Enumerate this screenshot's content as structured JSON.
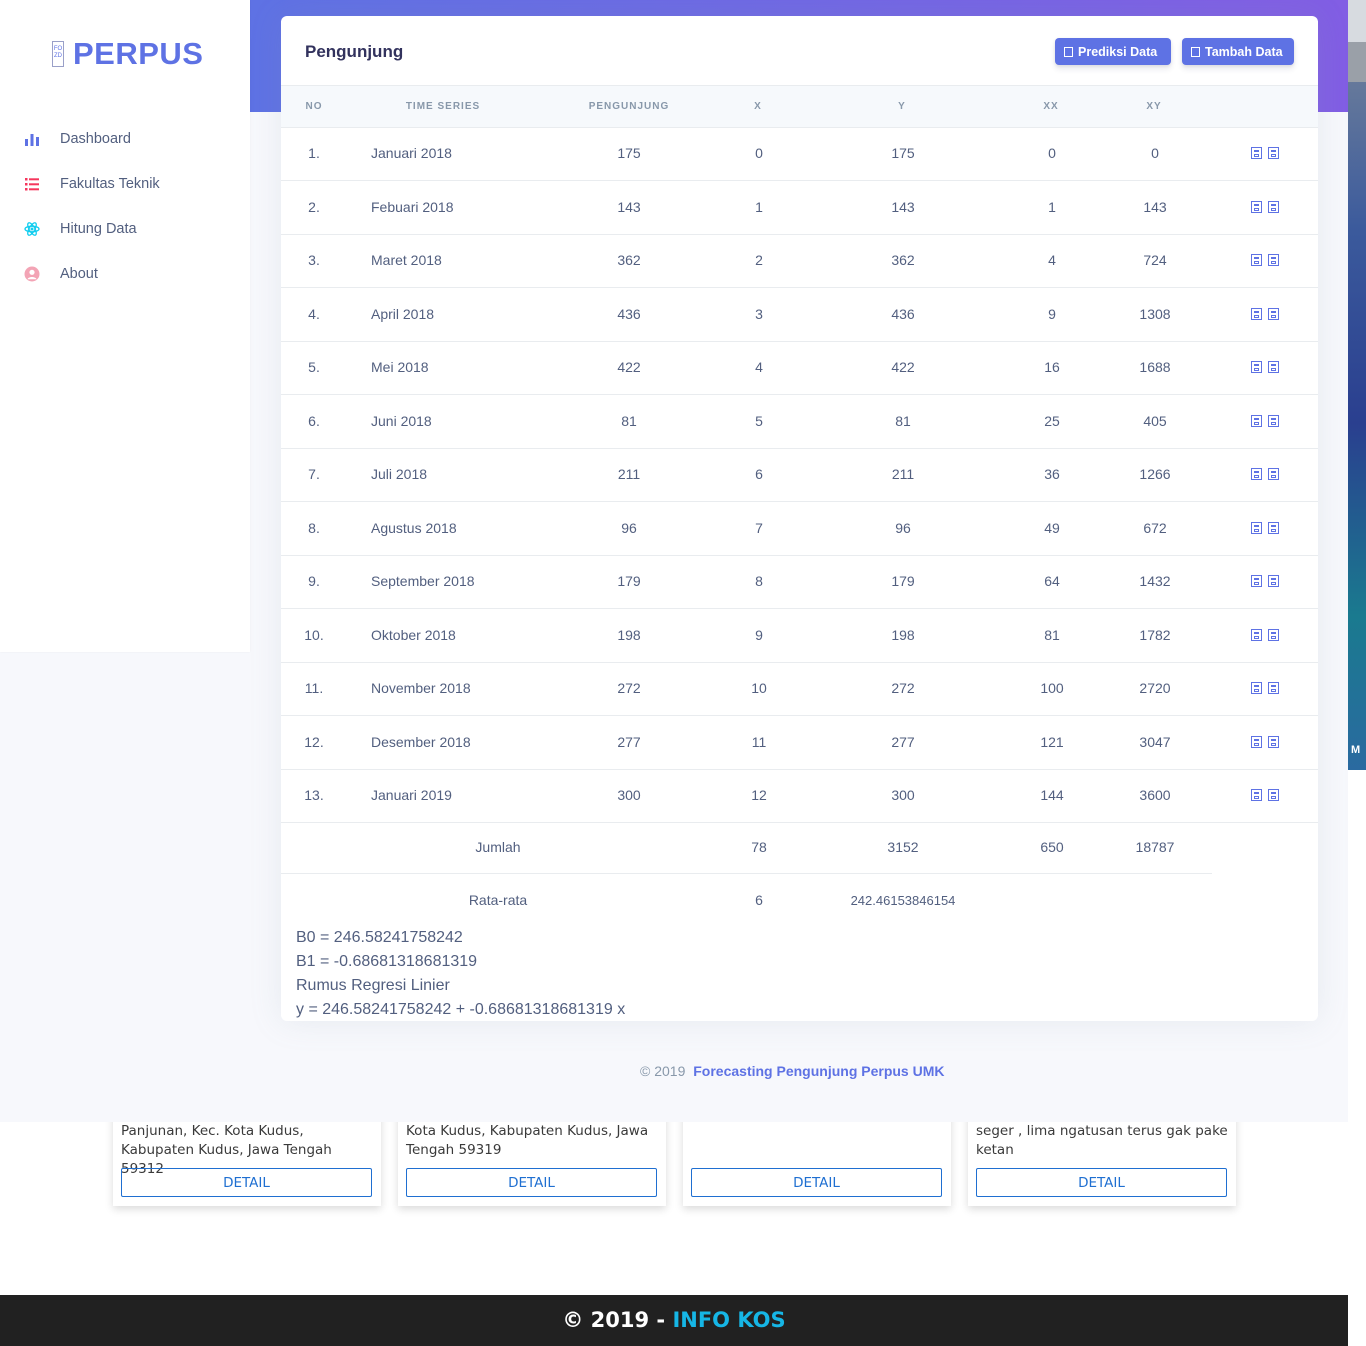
{
  "app": {
    "brand": "PERPUS",
    "brand_logo_text": "FO ZD"
  },
  "sidebar": {
    "items": [
      {
        "label": "Dashboard",
        "icon": "bar-chart-icon",
        "color": "#5e72e4"
      },
      {
        "label": "Fakultas Teknik",
        "icon": "list-icon",
        "color": "#f5365c"
      },
      {
        "label": "Hitung Data",
        "icon": "atom-icon",
        "color": "#11cdef"
      },
      {
        "label": "About",
        "icon": "user-circle-icon",
        "color": "#f3a4b5"
      }
    ]
  },
  "card": {
    "title": "Pengunjung",
    "buttons": {
      "predict_label": "Prediksi Data",
      "add_label": "Tambah Data"
    }
  },
  "table": {
    "headers": [
      "NO",
      "TIME SERIES",
      "PENGUNJUNG",
      "X",
      "Y",
      "XX",
      "XY"
    ],
    "rows": [
      {
        "no": "1.",
        "time": "Januari 2018",
        "pengunjung": "175",
        "x": "0",
        "y": "175",
        "xx": "0",
        "xy": "0"
      },
      {
        "no": "2.",
        "time": "Febuari 2018",
        "pengunjung": "143",
        "x": "1",
        "y": "143",
        "xx": "1",
        "xy": "143"
      },
      {
        "no": "3.",
        "time": "Maret 2018",
        "pengunjung": "362",
        "x": "2",
        "y": "362",
        "xx": "4",
        "xy": "724"
      },
      {
        "no": "4.",
        "time": "April 2018",
        "pengunjung": "436",
        "x": "3",
        "y": "436",
        "xx": "9",
        "xy": "1308"
      },
      {
        "no": "5.",
        "time": "Mei 2018",
        "pengunjung": "422",
        "x": "4",
        "y": "422",
        "xx": "16",
        "xy": "1688"
      },
      {
        "no": "6.",
        "time": "Juni 2018",
        "pengunjung": "81",
        "x": "5",
        "y": "81",
        "xx": "25",
        "xy": "405"
      },
      {
        "no": "7.",
        "time": "Juli 2018",
        "pengunjung": "211",
        "x": "6",
        "y": "211",
        "xx": "36",
        "xy": "1266"
      },
      {
        "no": "8.",
        "time": "Agustus 2018",
        "pengunjung": "96",
        "x": "7",
        "y": "96",
        "xx": "49",
        "xy": "672"
      },
      {
        "no": "9.",
        "time": "September 2018",
        "pengunjung": "179",
        "x": "8",
        "y": "179",
        "xx": "64",
        "xy": "1432"
      },
      {
        "no": "10.",
        "time": "Oktober 2018",
        "pengunjung": "198",
        "x": "9",
        "y": "198",
        "xx": "81",
        "xy": "1782"
      },
      {
        "no": "11.",
        "time": "November 2018",
        "pengunjung": "272",
        "x": "10",
        "y": "272",
        "xx": "100",
        "xy": "2720"
      },
      {
        "no": "12.",
        "time": "Desember 2018",
        "pengunjung": "277",
        "x": "11",
        "y": "277",
        "xx": "121",
        "xy": "3047"
      },
      {
        "no": "13.",
        "time": "Januari 2019",
        "pengunjung": "300",
        "x": "12",
        "y": "300",
        "xx": "144",
        "xy": "3600"
      }
    ],
    "sum": {
      "label": "Jumlah",
      "x": "78",
      "y": "3152",
      "xx": "650",
      "xy": "18787"
    },
    "avg": {
      "label": "Rata-rata",
      "x": "6",
      "y": "242.46153846154"
    }
  },
  "results": {
    "b0": "B0 = 246.58241758242",
    "b1": "B1 = -0.68681318681319",
    "formula_title": "Rumus Regresi Linier",
    "formula": "y = 246.58241758242 + -0.68681318681319 x"
  },
  "footer": {
    "copyright": "© 2019",
    "link": "Forecasting Pengunjung Perpus UMK"
  },
  "background_page": {
    "cards": [
      {
        "text": "Panjunan, Kec. Kota Kudus, Kabupaten Kudus, Jawa Tengah 59312",
        "button": "DETAIL"
      },
      {
        "text": "Kota Kudus, Kabupaten Kudus, Jawa Tengah 59319",
        "button": "DETAIL"
      },
      {
        "text": "",
        "button": "DETAIL"
      },
      {
        "text": "seger , lima ngatusan terus gak pake ketan",
        "button": "DETAIL"
      }
    ],
    "footer_prefix": "© 2019 - ",
    "footer_brand": "INFO KOS",
    "strip_char": "M"
  },
  "colors": {
    "primary": "#5e72e4",
    "gradient_end": "#825ee4",
    "text": "#525f7f",
    "footer_brand": "#16b6e6"
  }
}
